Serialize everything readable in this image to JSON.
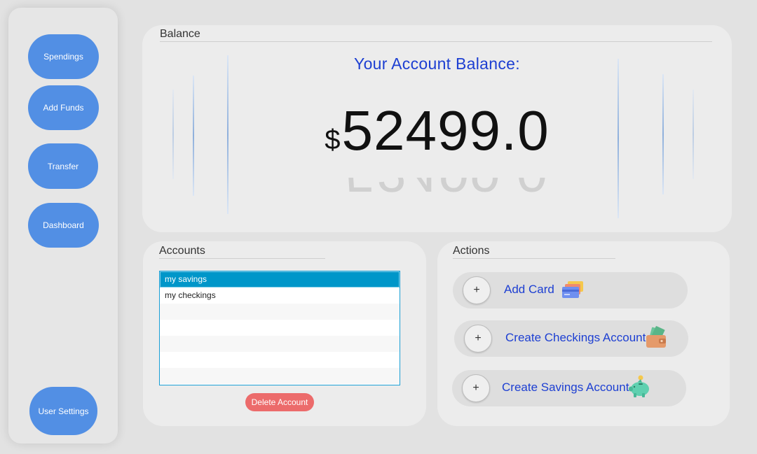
{
  "sidebar": {
    "items": [
      {
        "label": "Spendings"
      },
      {
        "label": "Add Funds"
      },
      {
        "label": "Transfer"
      },
      {
        "label": "Dashboard"
      }
    ],
    "user_settings_label": "User Settings"
  },
  "balance": {
    "section_title": "Balance",
    "caption": "Your Account Balance:",
    "currency_symbol": "$",
    "amount": "52499.0"
  },
  "accounts": {
    "section_title": "Accounts",
    "items": [
      "my savings",
      "my checkings"
    ],
    "selected_index": 0,
    "delete_label": "Delete Account"
  },
  "actions": {
    "section_title": "Actions",
    "items": [
      {
        "label": "Add Card",
        "plus": "+",
        "icon": "credit-card-icon"
      },
      {
        "label": "Create Checkings Account",
        "plus": "+",
        "icon": "wallet-icon"
      },
      {
        "label": "Create Savings Account",
        "plus": "+",
        "icon": "piggy-bank-icon"
      }
    ]
  },
  "colors": {
    "accent": "#528fe4",
    "text_accent": "#1d3fd2",
    "danger": "#ec6b6b",
    "selection": "#0096c9"
  }
}
